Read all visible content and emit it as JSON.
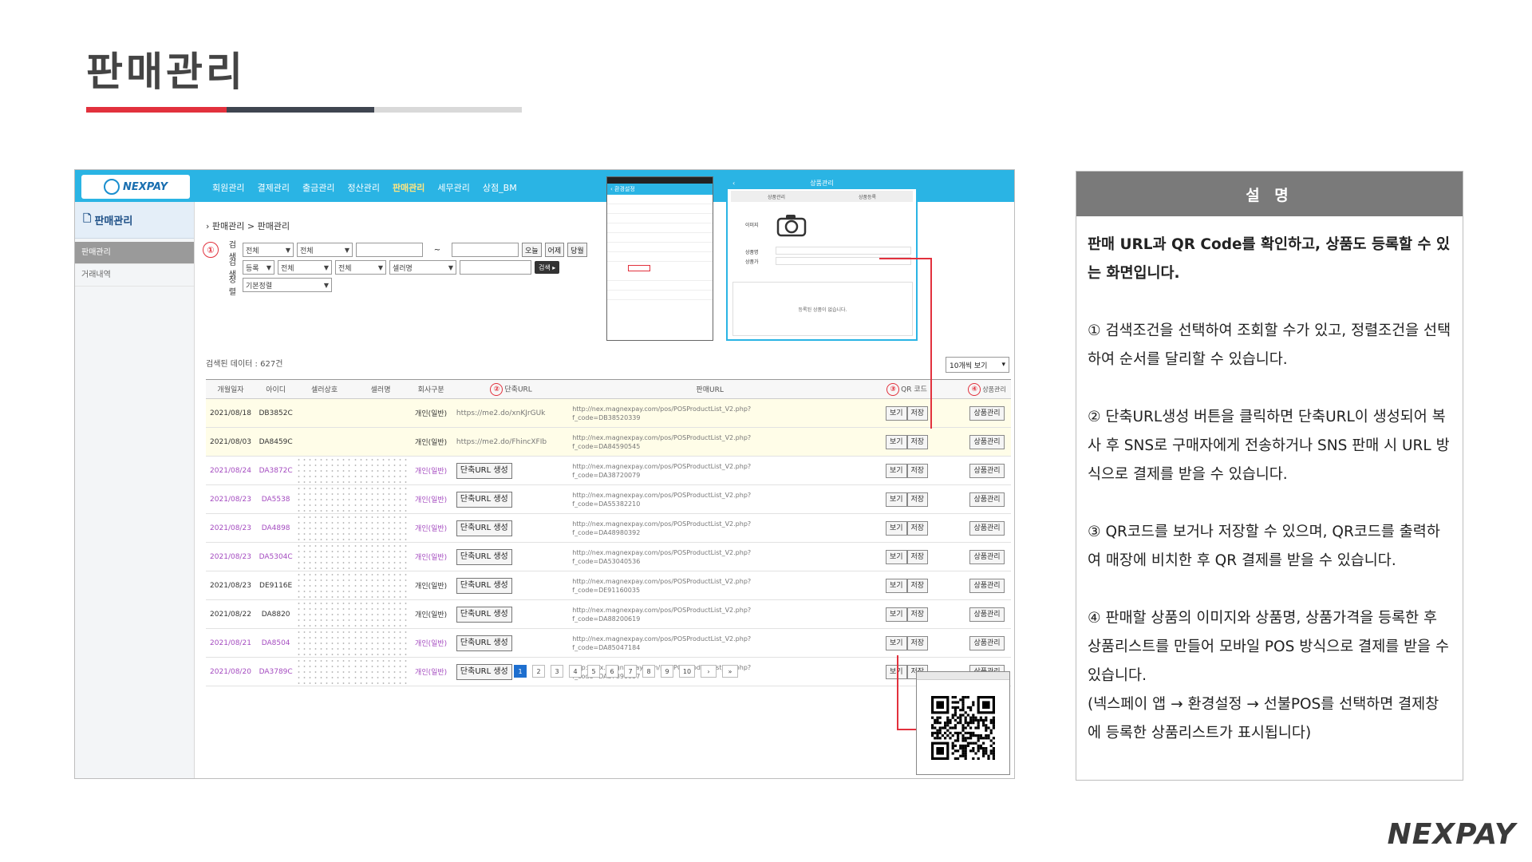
{
  "slide": {
    "title": "판매관리",
    "brand": "NEXPAY"
  },
  "app": {
    "logo_text": "NEXPAY",
    "nav": [
      "회원관리",
      "결제관리",
      "출금관리",
      "정산관리",
      "판매관리",
      "세무관리",
      "상점_BM"
    ],
    "sidebar": {
      "title": "판매관리",
      "items": [
        "판매관리",
        "거래내역"
      ]
    },
    "breadcrumb": "판매관리 > 판매관리",
    "search": {
      "label1": "검색",
      "label2": "검색",
      "label3": "정렬",
      "sel1": "전체",
      "sel2": "전체",
      "sel3": "등록",
      "sel4": "전체",
      "sel5": "전체",
      "sel6": "셀러명",
      "sort": "기본정렬",
      "tilde": "~",
      "btn_today": "오늘",
      "btn_yesterday": "어제",
      "btn_month": "당월",
      "btn_search": "검색 ▸"
    },
    "result_count": "검색된 데이터 : 627건",
    "page_size": "10개씩 보기",
    "columns": [
      "개월일자",
      "아이디",
      "셀러상호",
      "셀러명",
      "회사구분",
      "단축URL",
      "판매URL",
      "QR 코드",
      "상품관리"
    ],
    "rows": [
      {
        "date": "2021/08/18",
        "id": "DB3852C",
        "type": "개인(일반)",
        "short": "https://me2.do/xnKJrGUk",
        "url1": "http://nex.magnexpay.com/pos/POSProductList_V2.php?",
        "url2": "f_code=DB38520339",
        "purple": false,
        "hl": true
      },
      {
        "date": "2021/08/03",
        "id": "DA8459C",
        "type": "개인(일반)",
        "short": "https://me2.do/FhincXFIb",
        "url1": "http://nex.magnexpay.com/pos/POSProductList_V2.php?",
        "url2": "f_code=DA84590545",
        "purple": false,
        "hl": true
      },
      {
        "date": "2021/08/24",
        "id": "DA3872C",
        "type": "개인(일반)",
        "short": "",
        "url1": "http://nex.magnexpay.com/pos/POSProductList_V2.php?",
        "url2": "f_code=DA38720079",
        "purple": true,
        "hl": false
      },
      {
        "date": "2021/08/23",
        "id": "DA5538",
        "type": "개인(일반)",
        "short": "",
        "url1": "http://nex.magnexpay.com/pos/POSProductList_V2.php?",
        "url2": "f_code=DA55382210",
        "purple": true,
        "hl": false
      },
      {
        "date": "2021/08/23",
        "id": "DA4898",
        "type": "개인(일반)",
        "short": "",
        "url1": "http://nex.magnexpay.com/pos/POSProductList_V2.php?",
        "url2": "f_code=DA48980392",
        "purple": true,
        "hl": false
      },
      {
        "date": "2021/08/23",
        "id": "DA5304C",
        "type": "개인(일반)",
        "short": "",
        "url1": "http://nex.magnexpay.com/pos/POSProductList_V2.php?",
        "url2": "f_code=DA53040536",
        "purple": true,
        "hl": false
      },
      {
        "date": "2021/08/23",
        "id": "DE9116E",
        "type": "개인(일반)",
        "short": "",
        "url1": "http://nex.magnexpay.com/pos/POSProductList_V2.php?",
        "url2": "f_code=DE91160035",
        "purple": false,
        "hl": false
      },
      {
        "date": "2021/08/22",
        "id": "DA8820",
        "type": "개인(일반)",
        "short": "",
        "url1": "http://nex.magnexpay.com/pos/POSProductList_V2.php?",
        "url2": "f_code=DA88200619",
        "purple": false,
        "hl": false
      },
      {
        "date": "2021/08/21",
        "id": "DA8504",
        "type": "개인(일반)",
        "short": "",
        "url1": "http://nex.magnexpay.com/pos/POSProductList_V2.php?",
        "url2": "f_code=DA85047184",
        "purple": true,
        "hl": false
      },
      {
        "date": "2021/08/20",
        "id": "DA3789C",
        "type": "개인(일반)",
        "short": "",
        "url1": "http://nex.magnexpay.com/pos/POSProductList_V2.php?",
        "url2": "f_code=DA37890857",
        "purple": true,
        "hl": false
      }
    ],
    "btn_view": "보기",
    "btn_save": "저장",
    "btn_short": "단축URL 생성",
    "btn_manage": "상품관리",
    "pages": [
      "1",
      "2",
      "3",
      "4",
      "5",
      "6",
      "7",
      "8",
      "9",
      "10",
      "›",
      "»"
    ],
    "phone": {
      "title": "환경설정"
    },
    "dialog": {
      "title": "상품관리",
      "tab_left": "상품관리",
      "tab_right": "상품등록",
      "label_image": "이미지",
      "label_name": "상품명",
      "label_price": "상품가",
      "empty": "등록된 상품이 없습니다."
    }
  },
  "panel": {
    "header": "설 명",
    "lead": "판매 URL과 QR Code를 확인하고, 상품도 등록할 수 있는 화면입니다.",
    "p1": "① 검색조건을 선택하여 조회할 수가 있고, 정렬조건을 선택하여 순서를 달리할 수 있습니다.",
    "p2": "② 단축URL생성 버튼을 클릭하면 단축URL이 생성되어 복사 후 SNS로 구매자에게 전송하거나 SNS 판매 시 URL 방식으로 결제를 받을 수 있습니다.",
    "p3": "③ QR코드를 보거나 저장할 수 있으며, QR코드를 출력하여 매장에 비치한 후 QR 결제를 받을 수 있습니다.",
    "p4": "④ 판매할 상품의 이미지와 상품명, 상품가격을 등록한 후 상품리스트를 만들어 모바일 POS 방식으로 결제를 받을 수 있습니다.",
    "p4b": "(넥스페이 앱 → 환경설정 → 선불POS를 선택하면 결제창에 등록한 상품리스트가 표시됩니다)"
  },
  "badges": [
    "①",
    "②",
    "③",
    "④"
  ],
  "colors": {
    "accent_red": "#e2313d",
    "header_blue": "#2ab4e4",
    "panel_head": "#7a7a7a"
  }
}
